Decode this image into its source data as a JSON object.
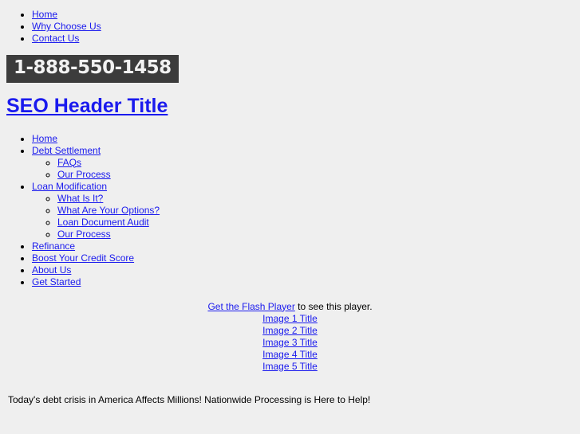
{
  "top_nav": {
    "items": [
      {
        "label": "Home"
      },
      {
        "label": "Why Choose Us"
      },
      {
        "label": "Contact Us"
      }
    ]
  },
  "phone_banner": {
    "number": "1-888-550-1458",
    "background_color": "#3c3c3c",
    "text_color": "#f2f2f2"
  },
  "seo_header": {
    "title": "SEO Header Title"
  },
  "main_nav": {
    "items": [
      {
        "label": "Home",
        "children": []
      },
      {
        "label": "Debt Settlement",
        "children": [
          {
            "label": "FAQs"
          },
          {
            "label": "Our Process"
          }
        ]
      },
      {
        "label": "Loan Modification",
        "children": [
          {
            "label": "What Is It?"
          },
          {
            "label": "What Are Your Options?"
          },
          {
            "label": "Loan Document Audit"
          },
          {
            "label": "Our Process"
          }
        ]
      },
      {
        "label": "Refinance",
        "children": []
      },
      {
        "label": "Boost Your Credit Score",
        "children": []
      },
      {
        "label": "About Us",
        "children": []
      },
      {
        "label": "Get Started",
        "children": []
      }
    ]
  },
  "player": {
    "flash_link_label": "Get the Flash Player",
    "flash_suffix": " to see this player.",
    "image_titles": [
      {
        "label": "Image 1 Title"
      },
      {
        "label": "Image 2 Title"
      },
      {
        "label": "Image 3 Title"
      },
      {
        "label": "Image 4 Title"
      },
      {
        "label": "Image 5 Title"
      }
    ]
  },
  "tagline": {
    "text": "Today's debt crisis in America Affects Millions! Nationwide Processing is Here to Help!"
  },
  "theme": {
    "background_color": "#efefef",
    "link_color": "#1a1aee",
    "text_color": "#000000"
  }
}
